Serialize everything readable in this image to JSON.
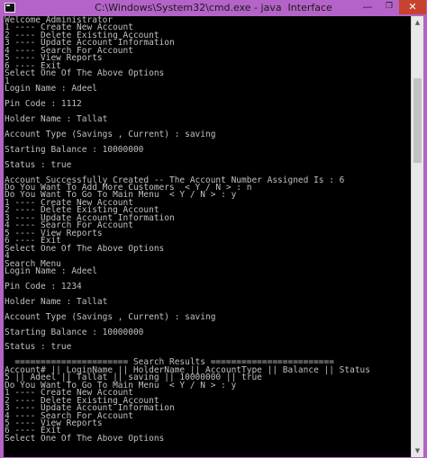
{
  "window": {
    "title": "C:\\Windows\\System32\\cmd.exe - java  Interface",
    "controls": {
      "minimize": "—",
      "maximize": "❐",
      "close": "✕"
    },
    "colors": {
      "frame": "#b463c8",
      "close_button": "#c7432f",
      "console_background": "#000000",
      "console_text": "#c0c0c0"
    }
  },
  "console": {
    "lines": [
      "Welcome Administrator",
      "1 ---- Create New Account",
      "2 ---- Delete Existing Account",
      "3 ---- Update Account Information",
      "4 ---- Search For Account",
      "5 ---- View Reports",
      "6 ---- Exit",
      "Select One Of The Above Options",
      "1",
      "Login Name : Adeel",
      "",
      "Pin Code : 1112",
      "",
      "Holder Name : Tallat",
      "",
      "Account Type (Savings , Current) : saving",
      "",
      "Starting Balance : 10000000",
      "",
      "Status : true",
      "",
      "Account Successfully Created -- The Account Number Assigned Is : 6",
      "Do You Want To Add More Customers  < Y / N > : n",
      "Do You Want To Go To Main Menu  < Y / N > : y",
      "1 ---- Create New Account",
      "2 ---- Delete Existing Account",
      "3 ---- Update Account Information",
      "4 ---- Search For Account",
      "5 ---- View Reports",
      "6 ---- Exit",
      "Select One Of The Above Options",
      "4",
      "Search Menu",
      "Login Name : Adeel",
      "",
      "Pin Code : 1234",
      "",
      "Holder Name : Tallat",
      "",
      "Account Type (Savings , Current) : saving",
      "",
      "Starting Balance : 10000000",
      "",
      "Status : true",
      "",
      "  ====================== Search Results ========================",
      "Account# || LoginName || HolderName || AccountType || Balance || Status",
      "5 || Adeel || Tallat || saving || 10000000 || true",
      "Do You Want To Go To Main Menu  < Y / N > : y",
      "1 ---- Create New Account",
      "2 ---- Delete Existing Account",
      "3 ---- Update Account Information",
      "4 ---- Search For Account",
      "5 ---- View Reports",
      "6 ---- Exit",
      "Select One Of The Above Options"
    ]
  },
  "scrollbar": {
    "up_arrow": "▲",
    "down_arrow": "▼",
    "position_fraction": 0.15
  }
}
